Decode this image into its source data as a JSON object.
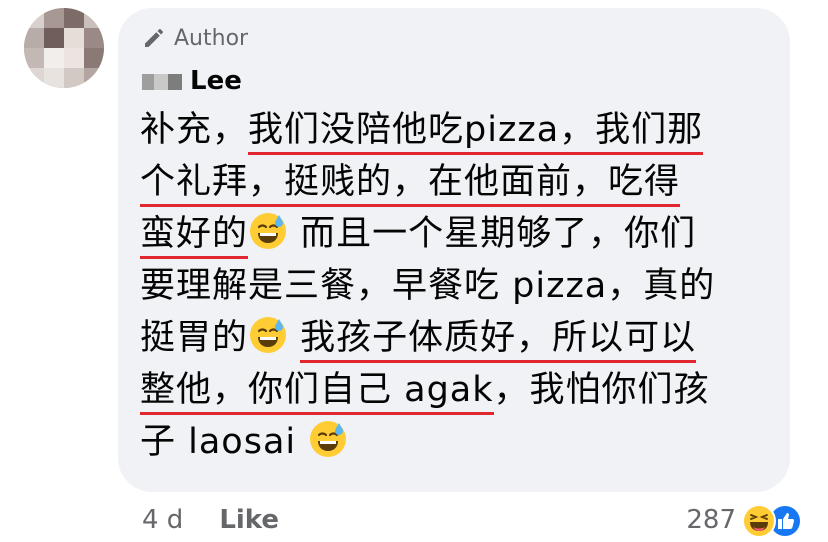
{
  "comment": {
    "author_badge": "Author",
    "author_name": "Lee",
    "lines": [
      {
        "segments": [
          {
            "t": "补充，",
            "u": false
          },
          {
            "t": "我们没陪他吃pizza，我们那",
            "u": true
          }
        ]
      },
      {
        "segments": [
          {
            "t": "个礼拜，挺贱的，在他面前，吃得",
            "u": true
          }
        ]
      },
      {
        "segments": [
          {
            "t": "蛮好的",
            "u": true
          },
          {
            "emoji": "sweat-smile-emoji"
          },
          {
            "t": " 而且一个星期够了，你们",
            "u": false
          }
        ]
      },
      {
        "segments": [
          {
            "t": "要理解是三餐，早餐吃 pizza，真的",
            "u": false
          }
        ]
      },
      {
        "segments": [
          {
            "t": "挺胃的",
            "u": false
          },
          {
            "emoji": "sweat-smile-emoji"
          },
          {
            "t": " ",
            "u": false
          },
          {
            "t": "我孩子体质好，所以可以",
            "u": true
          }
        ]
      },
      {
        "segments": [
          {
            "t": "整他，你们自己 agak",
            "u": true
          },
          {
            "t": "，我怕你们孩",
            "u": false
          }
        ]
      },
      {
        "segments": [
          {
            "t": "子 laosai ",
            "u": false
          },
          {
            "emoji": "sweat-smile-emoji"
          }
        ]
      }
    ]
  },
  "footer": {
    "time": "4 d",
    "like_label": "Like",
    "reaction_count": "287",
    "reaction_icons": [
      "laugh-reaction-icon",
      "like-reaction-icon"
    ]
  },
  "colors": {
    "bubble": "#f0f2f5",
    "underline": "#e0262f",
    "muted_text": "#65676b",
    "like_blue": "#1877f2",
    "emoji_yellow": "#ffcc33"
  }
}
